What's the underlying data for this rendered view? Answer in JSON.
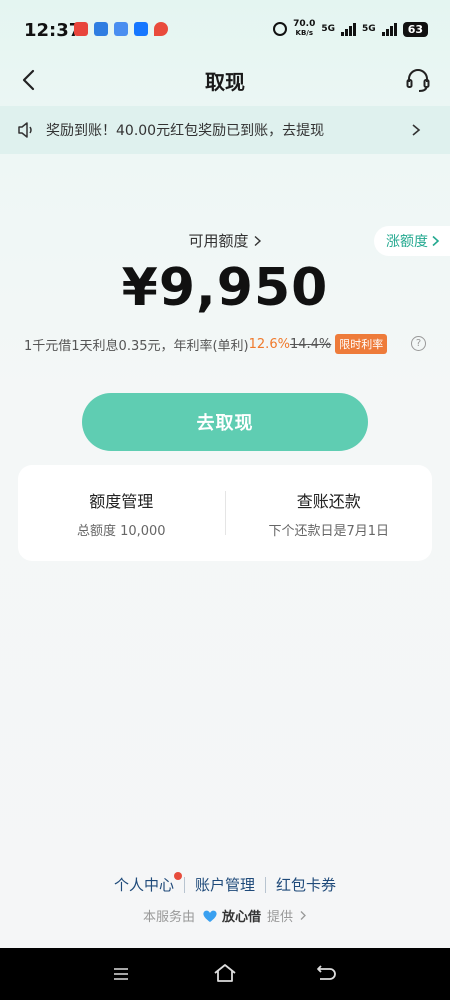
{
  "status": {
    "time": "12:37",
    "net_speed_value": "70.0",
    "net_speed_unit": "KB/s",
    "sig1": "5G",
    "sig2": "5G",
    "battery": "63"
  },
  "nav": {
    "title": "取现"
  },
  "notice": {
    "text": "奖励到账！40.00元红包奖励已到账，去提现"
  },
  "credit": {
    "label": "可用额度",
    "amount": "¥9,950",
    "raise_limit": "涨额度"
  },
  "rate": {
    "prefix": "1千元借1天利息0.35元，年利率(单利)",
    "current": "12.6%",
    "original": "14.4%",
    "badge": "限时利率",
    "help": "?"
  },
  "withdraw_button": "去取现",
  "card": {
    "left_title": "额度管理",
    "left_sub": "总额度 10,000",
    "right_title": "查账还款",
    "right_sub": "下个还款日是7月1日"
  },
  "footer": {
    "links": [
      "个人中心",
      "账户管理",
      "红包卡券"
    ],
    "service_prefix": "本服务由",
    "brand": "放心借",
    "service_suffix": "提供"
  },
  "colors": {
    "accent": "#5fcdb2",
    "accent_text": "#24a990",
    "highlight": "#f07a2c",
    "link": "#1f4a7a"
  }
}
